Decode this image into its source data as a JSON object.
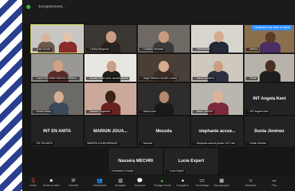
{
  "window": {
    "title": "Enregistrement..."
  },
  "view_button": "Composer vue avec en plein",
  "tiles": [
    {
      "name": "Julie Boudin"
    },
    {
      "name": "Cécilia Mingueux"
    },
    {
      "name": "Christian Bertrand"
    },
    {
      "name": "Hédi Bernier"
    },
    {
      "name": "Bettina"
    },
    {
      "name": "Laure KOCINSKI WATCH, Référent..."
    },
    {
      "name": "Aurélie Paris Lamb, accueil jeunes"
    },
    {
      "name": "Angie Séchen Lila (MC-Lance)"
    },
    {
      "name": "Sarah (Conteur)"
    },
    {
      "name": "Fiona"
    },
    {
      "name": "Emilie Edang"
    },
    {
      "name": "Manaris Legendre"
    },
    {
      "name": "Aubrey lord"
    },
    {
      "name": "Marie LAVAUD"
    },
    {
      "name": "INT Angela Kent",
      "label": "INT Angela Kent"
    },
    {
      "name": "INT EN ANITA",
      "label": "INT EN ANITA"
    },
    {
      "name": "MARION JOUAN RENAUD",
      "label": "MARION JOUA..."
    },
    {
      "name": "Mouzda",
      "label": "Mouzda"
    },
    {
      "name": "stephanie accueil jeunes 11/17 ans",
      "label": "stephanie accue..."
    },
    {
      "name": "Dunia Jiménez",
      "label": "Dunia Jiménez"
    },
    {
      "name": "Connexion à l'audio",
      "label": "Nasséra MECHRI"
    },
    {
      "name": "Lucie Expert",
      "label": "Lucie Expert"
    }
  ],
  "toolbar": [
    {
      "icon": "mic-muted-icon",
      "glyph": "🎙",
      "label": "Activer"
    },
    {
      "icon": "video-icon",
      "glyph": "■",
      "label": "Arrêter la vidéo"
    },
    {
      "icon": "security-icon",
      "glyph": "⛨",
      "label": "Sécurité"
    },
    {
      "icon": "participants-icon",
      "glyph": "👥",
      "label": "Participants"
    },
    {
      "icon": "polls-icon",
      "glyph": "▥",
      "label": "Sondages"
    },
    {
      "icon": "chat-icon",
      "glyph": "💬",
      "label": "Converser"
    },
    {
      "icon": "share-screen-icon",
      "glyph": "▲",
      "label": "Partager l'écran"
    },
    {
      "icon": "record-icon",
      "glyph": "●",
      "label": "Enregistrer"
    },
    {
      "icon": "captions-icon",
      "glyph": "CC",
      "label": "Sous-titrage"
    },
    {
      "icon": "breakout-icon",
      "glyph": "▦",
      "label": "Sous-groupes"
    },
    {
      "icon": "reactions-icon",
      "glyph": "☺",
      "label": "Réactions"
    },
    {
      "icon": "more-icon",
      "glyph": "•••",
      "label": "Plus"
    }
  ]
}
